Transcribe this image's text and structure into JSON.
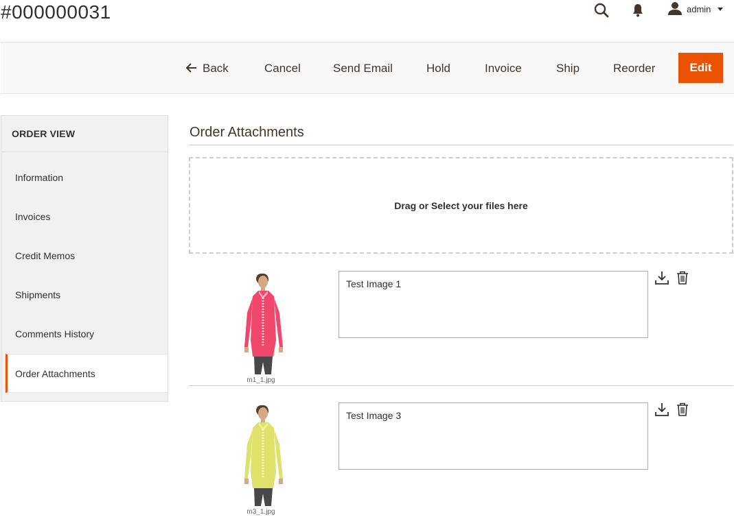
{
  "header": {
    "title": "#000000031",
    "user": "admin",
    "icons": [
      "search-icon",
      "bell-icon",
      "user-icon",
      "chevron-down-icon"
    ]
  },
  "actions": {
    "back": "Back",
    "cancel": "Cancel",
    "send_email": "Send Email",
    "hold": "Hold",
    "invoice": "Invoice",
    "ship": "Ship",
    "reorder": "Reorder",
    "edit": "Edit"
  },
  "sidebar": {
    "title": "ORDER VIEW",
    "items": [
      {
        "label": "Information"
      },
      {
        "label": "Invoices"
      },
      {
        "label": "Credit Memos"
      },
      {
        "label": "Shipments"
      },
      {
        "label": "Comments History"
      },
      {
        "label": "Order Attachments"
      }
    ],
    "active_item": "Order Attachments"
  },
  "main": {
    "title": "Order Attachments",
    "dropzone_text": "Drag or Select your files here",
    "attachments": [
      {
        "filename": "m1_1.jpg",
        "caption": "Test Image 1",
        "shirt_color": "#f2476d"
      },
      {
        "filename": "m3_1.jpg",
        "caption": "Test Image 3",
        "shirt_color": "#dde36a"
      }
    ]
  },
  "colors": {
    "accent": "#eb5202",
    "sidebar_bg": "#f1f1f1"
  }
}
